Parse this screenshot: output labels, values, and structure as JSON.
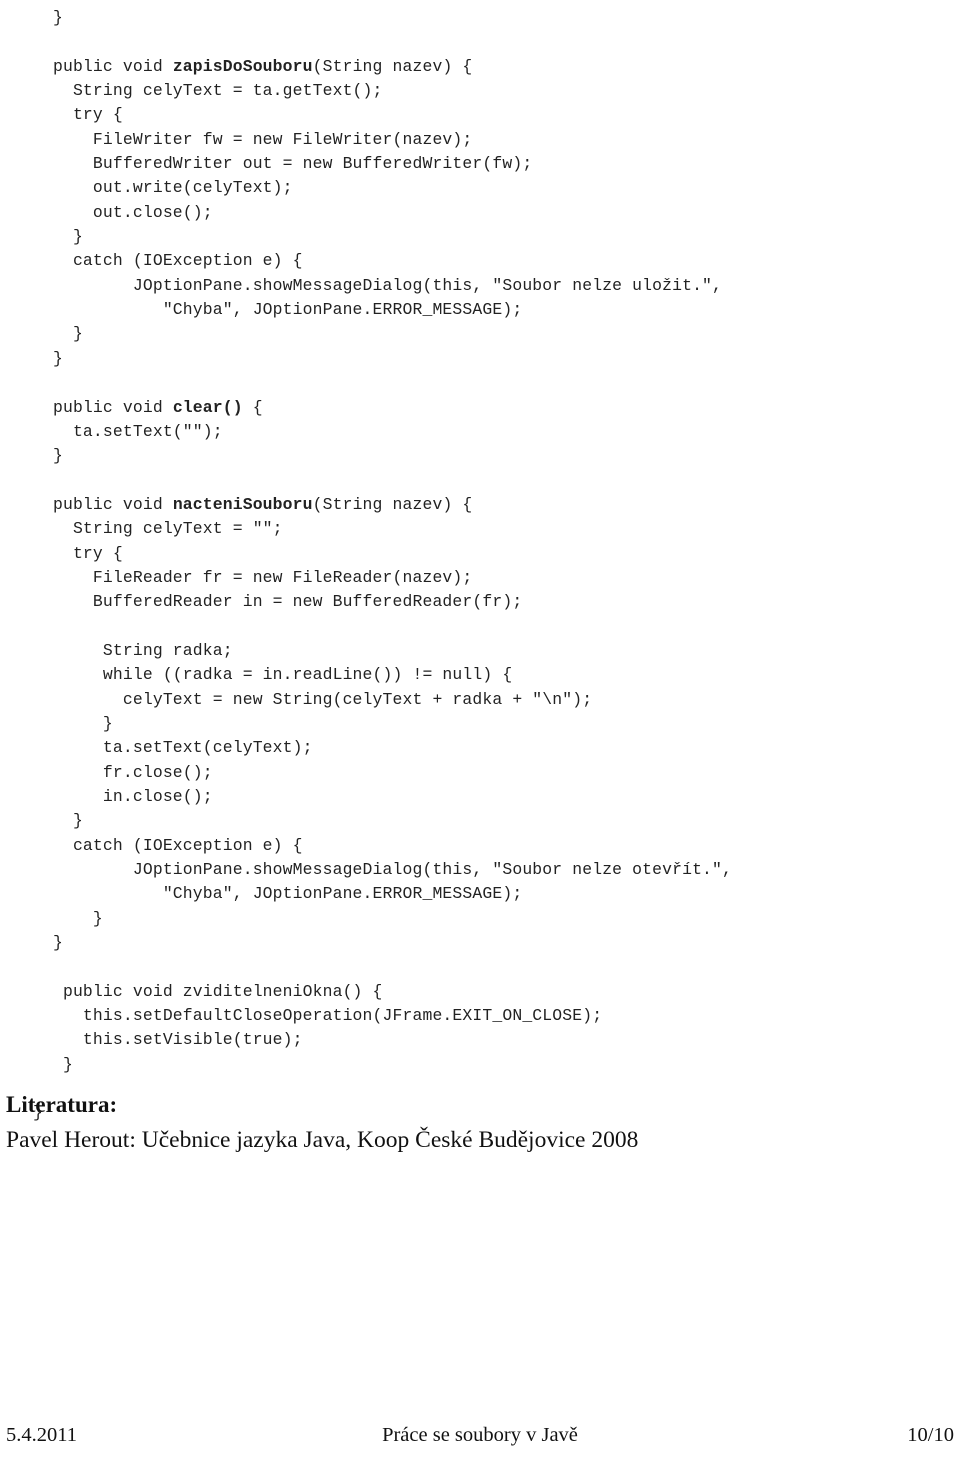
{
  "document": {
    "kind": "lecture-handout-page",
    "language": "cs"
  },
  "code": {
    "language": "Java",
    "lines": [
      {
        "indent": 2,
        "text": "}"
      },
      {
        "indent": 0,
        "text": "",
        "blank": true
      },
      {
        "indent": 2,
        "text": "public void ",
        "bold": "zapisDoSouboru",
        "after": "(String nazev) {"
      },
      {
        "indent": 4,
        "text": "String celyText = ta.getText();"
      },
      {
        "indent": 4,
        "text": "try {"
      },
      {
        "indent": 6,
        "text": "FileWriter fw = new FileWriter(nazev);"
      },
      {
        "indent": 6,
        "text": "BufferedWriter out = new BufferedWriter(fw);"
      },
      {
        "indent": 6,
        "text": "out.write(celyText);"
      },
      {
        "indent": 6,
        "text": "out.close();"
      },
      {
        "indent": 4,
        "text": "}"
      },
      {
        "indent": 4,
        "text": "catch (IOException e) {"
      },
      {
        "indent": 10,
        "text": "JOptionPane.showMessageDialog(this, \"Soubor nelze uložit.\","
      },
      {
        "indent": 13,
        "text": "\"Chyba\", JOptionPane.ERROR_MESSAGE);"
      },
      {
        "indent": 4,
        "text": "}"
      },
      {
        "indent": 2,
        "text": "}"
      },
      {
        "indent": 0,
        "text": "",
        "blank": true
      },
      {
        "indent": 2,
        "text": "public void ",
        "bold": "clear()",
        "after": " {"
      },
      {
        "indent": 4,
        "text": "ta.setText(\"\");"
      },
      {
        "indent": 2,
        "text": "}"
      },
      {
        "indent": 0,
        "text": "",
        "blank": true
      },
      {
        "indent": 2,
        "text": "public void ",
        "bold": "nacteniSouboru",
        "after": "(String nazev) {"
      },
      {
        "indent": 4,
        "text": "String celyText = \"\";"
      },
      {
        "indent": 4,
        "text": "try {"
      },
      {
        "indent": 6,
        "text": "FileReader fr = new FileReader(nazev);"
      },
      {
        "indent": 6,
        "text": "BufferedReader in = new BufferedReader(fr);"
      },
      {
        "indent": 0,
        "text": "",
        "blank": true
      },
      {
        "indent": 7,
        "text": "String radka;"
      },
      {
        "indent": 7,
        "text": "while ((radka = in.readLine()) != null) {"
      },
      {
        "indent": 9,
        "text": "celyText = new String(celyText + radka + \"\\n\");"
      },
      {
        "indent": 7,
        "text": "}"
      },
      {
        "indent": 7,
        "text": "ta.setText(celyText);"
      },
      {
        "indent": 7,
        "text": "fr.close();"
      },
      {
        "indent": 7,
        "text": "in.close();"
      },
      {
        "indent": 4,
        "text": "}"
      },
      {
        "indent": 4,
        "text": "catch (IOException e) {"
      },
      {
        "indent": 10,
        "text": "JOptionPane.showMessageDialog(this, \"Soubor nelze otevřít.\","
      },
      {
        "indent": 13,
        "text": "\"Chyba\", JOptionPane.ERROR_MESSAGE);"
      },
      {
        "indent": 6,
        "text": "}"
      },
      {
        "indent": 2,
        "text": "}"
      },
      {
        "indent": 0,
        "text": "",
        "blank": true
      },
      {
        "indent": 3,
        "text": "public void zviditelneniOkna() {"
      },
      {
        "indent": 5,
        "text": "this.setDefaultCloseOperation(JFrame.EXIT_ON_CLOSE);"
      },
      {
        "indent": 5,
        "text": "this.setVisible(true);"
      },
      {
        "indent": 3,
        "text": "}"
      },
      {
        "indent": 0,
        "text": "",
        "blank": true
      },
      {
        "indent": 0,
        "text": "}"
      }
    ]
  },
  "literature": {
    "heading": "Literatura:",
    "citation": "Pavel Herout: Učebnice jazyka Java, Koop České Budějovice 2008"
  },
  "footer": {
    "date": "5.4.2011",
    "title": "Práce se soubory v Javě",
    "page": "10/10"
  }
}
